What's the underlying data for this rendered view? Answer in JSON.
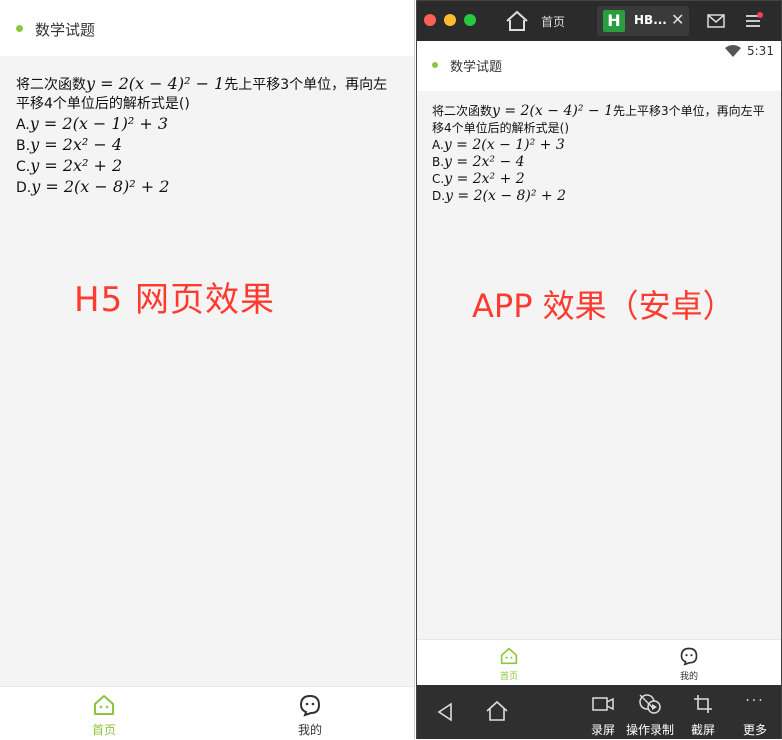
{
  "h5": {
    "header_title": "数学试题",
    "question": {
      "prefix": "将二次函数",
      "formula": "y = 2(x − 4)² − 1",
      "suffix": "先上平移3个单位，再向左平移4个单位后的解析式是()"
    },
    "options": [
      {
        "label": "A.",
        "formula": "y = 2(x − 1)² + 3"
      },
      {
        "label": "B.",
        "formula": "y = 2x² − 4"
      },
      {
        "label": "C.",
        "formula": "y = 2x² + 2"
      },
      {
        "label": "D.",
        "formula": "y = 2(x − 8)² + 2"
      }
    ],
    "caption": "H5 网页效果",
    "tabs": [
      {
        "label": "首页",
        "icon": "home-face-icon",
        "active": true
      },
      {
        "label": "我的",
        "icon": "profile-face-icon",
        "active": false
      }
    ]
  },
  "emulator": {
    "window_tabs": {
      "home_label": "首页",
      "app_label": "HB...",
      "app_logo": "H"
    },
    "status_time": "5:31",
    "header_title": "数学试题",
    "question": {
      "prefix": "将二次函数",
      "formula": "y = 2(x − 4)² − 1",
      "suffix": "先上平移3个单位，再向左平移4个单位后的解析式是()"
    },
    "options": [
      {
        "label": "A.",
        "formula": "y = 2(x − 1)² + 3"
      },
      {
        "label": "B.",
        "formula": "y = 2x² − 4"
      },
      {
        "label": "C.",
        "formula": "y = 2x² + 2"
      },
      {
        "label": "D.",
        "formula": "y = 2(x − 8)² + 2"
      }
    ],
    "caption": "APP 效果（安卓）",
    "tabs": [
      {
        "label": "首页",
        "active": true
      },
      {
        "label": "我的",
        "active": false
      }
    ],
    "toolbar": [
      {
        "label": "录屏",
        "icon": "video-camera-icon"
      },
      {
        "label": "操作录制",
        "icon": "record-operation-icon"
      },
      {
        "label": "截屏",
        "icon": "crop-icon"
      },
      {
        "label": "更多",
        "icon": "more-icon"
      }
    ]
  },
  "colors": {
    "accent_green": "#8cc63f",
    "caption_red": "#ff3b2f",
    "emulator_dark": "#2b2b2b"
  }
}
